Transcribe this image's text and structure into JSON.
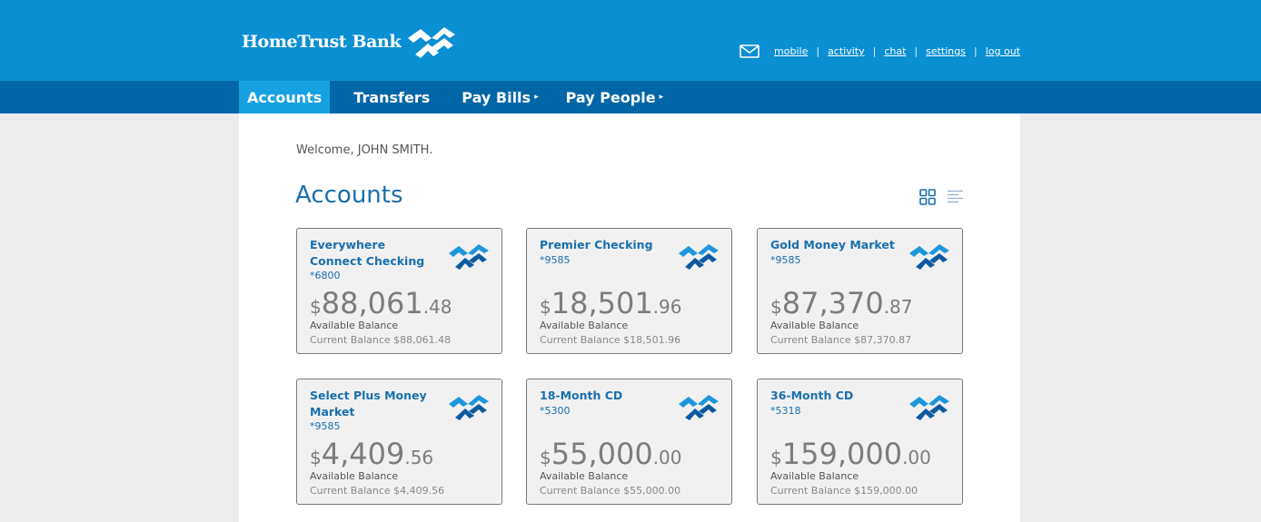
{
  "brand": {
    "name": "HomeTrust Bank",
    "logo_icon": "hometrust-logo-icon",
    "color": "#0a8fd3"
  },
  "utility_nav": {
    "mail_icon": "envelope-icon",
    "links": [
      "mobile",
      "activity",
      "chat",
      "settings",
      "log out"
    ],
    "separator": "|"
  },
  "main_nav": [
    {
      "label": "Accounts",
      "active": true
    },
    {
      "label": "Transfers"
    },
    {
      "label": "Pay Bills",
      "caret": "▸"
    },
    {
      "label": "Pay People",
      "caret": "▸"
    }
  ],
  "welcome": "Welcome, JOHN SMITH.",
  "page_title": "Accounts",
  "view_toggle": {
    "grid_icon": "grid-view-icon",
    "list_icon": "list-view-icon"
  },
  "accounts": [
    {
      "name": "Everywhere Connect Checking",
      "number": "*6800",
      "currency": "$",
      "whole": "88,061",
      "cents": ".48",
      "available_label": "Available Balance",
      "current": "Current Balance $88,061.48"
    },
    {
      "name": "Premier Checking",
      "number": "*9585",
      "currency": "$",
      "whole": "18,501",
      "cents": ".96",
      "available_label": "Available Balance",
      "current": "Current Balance $18,501.96"
    },
    {
      "name": "Gold Money Market",
      "number": "*9585",
      "currency": "$",
      "whole": "87,370",
      "cents": ".87",
      "available_label": "Available Balance",
      "current": "Current Balance $87,370.87"
    },
    {
      "name": "Select Plus Money Market",
      "number": "*9585",
      "currency": "$",
      "whole": "4,409",
      "cents": ".56",
      "available_label": "Available Balance",
      "current": "Current Balance $4,409.56"
    },
    {
      "name": "18-Month CD",
      "number": "*5300",
      "currency": "$",
      "whole": "55,000",
      "cents": ".00",
      "available_label": "Available Balance",
      "current": "Current Balance $55,000.00"
    },
    {
      "name": "36-Month CD",
      "number": "*5318",
      "currency": "$",
      "whole": "159,000",
      "cents": ".00",
      "available_label": "Available Balance",
      "current": "Current Balance $159,000.00"
    }
  ],
  "colors": {
    "nav_bar": "#0066a8",
    "active_tab": "#16a1e3",
    "link_blue": "#1a6fad"
  }
}
